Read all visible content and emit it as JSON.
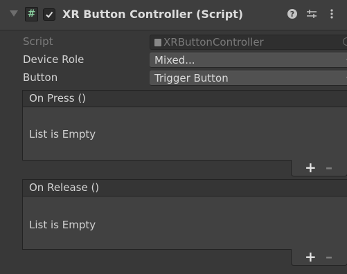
{
  "component": {
    "script_icon_glyph": "#",
    "title": "XR Button Controller (Script)",
    "enabled": true
  },
  "fields": {
    "script": {
      "label": "Script",
      "value": "XRButtonController"
    },
    "device_role": {
      "label": "Device Role",
      "value": "Mixed..."
    },
    "button": {
      "label": "Button",
      "value": "Trigger Button"
    }
  },
  "events": [
    {
      "title": "On Press ()",
      "empty_text": "List is Empty",
      "add_label": "+",
      "remove_label": "–"
    },
    {
      "title": "On Release ()",
      "empty_text": "List is Empty",
      "add_label": "+",
      "remove_label": "–"
    }
  ]
}
